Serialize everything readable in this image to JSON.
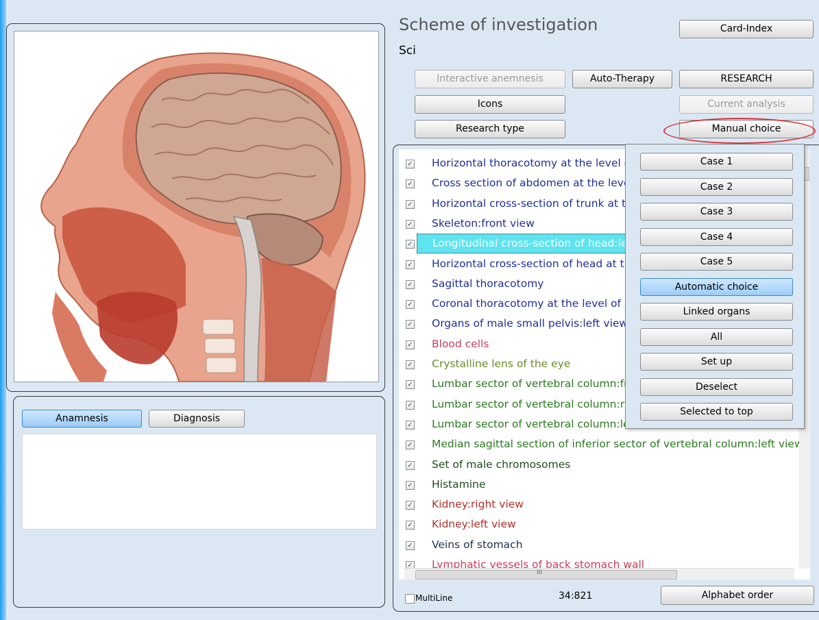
{
  "header": {
    "title": "Scheme of investigation",
    "subtitle": "Sci"
  },
  "toolbar": {
    "card_index": "Card-Index",
    "interactive_anamnesis": "Interactive anemnesis",
    "auto_therapy": "Auto-Therapy",
    "research": "RESEARCH",
    "icons": "Icons",
    "current_analysis": "Current analysis",
    "research_type": "Research type",
    "manual_choice": "Manual choice"
  },
  "bottom_tabs": {
    "anamnesis": "Anamnesis",
    "diagnosis": "Diagnosis"
  },
  "list": {
    "items": [
      {
        "label": "Horizontal thoracotomy at the level o",
        "color": "#1f2f9a",
        "checked": true
      },
      {
        "label": "Cross section of abdomen at the leve",
        "color": "#1f2f9a",
        "checked": true
      },
      {
        "label": "Horizontal cross-section of trunk at th",
        "color": "#1f2f9a",
        "checked": true
      },
      {
        "label": "Skeleton:front view",
        "color": "#1f2f9a",
        "checked": true
      },
      {
        "label": "Longitudinal cross-section of head:lef",
        "color": "#ffffff",
        "checked": true,
        "selected": true
      },
      {
        "label": "Horizontal cross-section of head at th",
        "color": "#1f2f9a",
        "checked": true
      },
      {
        "label": "Sagittal thoracotomy",
        "color": "#1f2f9a",
        "checked": true
      },
      {
        "label": "Coronal thoracotomy at the level of a",
        "color": "#1f2f9a",
        "checked": true
      },
      {
        "label": "Organs of male small pelvis:left view",
        "color": "#1f2f9a",
        "checked": true
      },
      {
        "label": "Blood cells",
        "color": "#c4405c",
        "checked": true
      },
      {
        "label": "Crystalline lens of the eye",
        "color": "#6b8a2a",
        "checked": true
      },
      {
        "label": "Lumbar sector of vertebral column:fr",
        "color": "#2a7a1f",
        "checked": true
      },
      {
        "label": "Lumbar sector of vertebral column:rig",
        "color": "#2a7a1f",
        "checked": true
      },
      {
        "label": "Lumbar sector of vertebral column:le",
        "color": "#2a7a1f",
        "checked": true
      },
      {
        "label": "Median sagittal section of inferior sector of vertebral column:left view",
        "color": "#2a7a1f",
        "checked": true
      },
      {
        "label": "Set of male chromosomes",
        "color": "#1f4a1f",
        "checked": true
      },
      {
        "label": "Histamine",
        "color": "#1f4a1f",
        "checked": true
      },
      {
        "label": "Kidney:right view",
        "color": "#b0302a",
        "checked": true
      },
      {
        "label": "Kidney:left view",
        "color": "#b0302a",
        "checked": true
      },
      {
        "label": "Veins of stomach",
        "color": "#1f2f4a",
        "checked": true
      },
      {
        "label": "Lymphatic vessels of back stomach wall",
        "color": "#c4405c",
        "checked": true
      }
    ]
  },
  "footer": {
    "multiline_label": "MultiLine",
    "counter": "34:821",
    "alphabet_order": "Alphabet order"
  },
  "popup": {
    "buttons": [
      "Case 1",
      "Case 2",
      "Case 3",
      "Case 4",
      "Case 5",
      "Automatic choice",
      "Linked organs",
      "All",
      "Set up",
      "Deselect",
      "Selected to top"
    ],
    "active_index": 5
  },
  "scrollbar": {
    "h_grip": "III"
  }
}
